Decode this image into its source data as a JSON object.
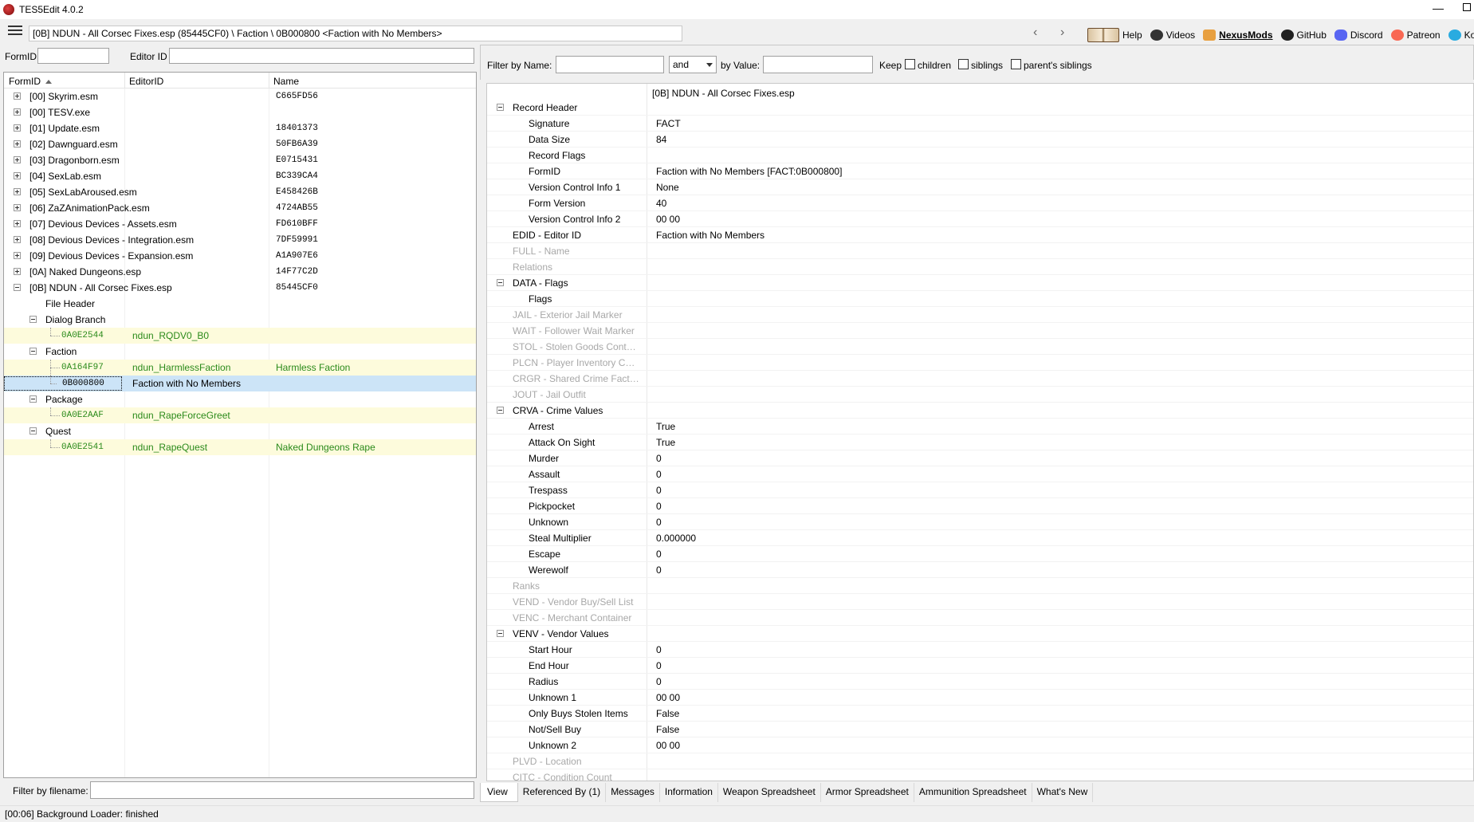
{
  "window": {
    "title": "TES5Edit 4.0.2"
  },
  "toolbar": {
    "path": "[0B] NDUN - All Corsec Fixes.esp (85445CF0) \\ Faction \\ 0B000800 <Faction with No Members>",
    "links": [
      {
        "label": "Help",
        "icon": "book-icon"
      },
      {
        "label": "Videos",
        "icon": "videos-icon"
      },
      {
        "label": "NexusMods",
        "icon": "nexusmods-icon"
      },
      {
        "label": "GitHub",
        "icon": "github-icon"
      },
      {
        "label": "Discord",
        "icon": "discord-icon"
      },
      {
        "label": "Patreon",
        "icon": "patreon-icon"
      },
      {
        "label": "Ko-Fi",
        "icon": "kofi-icon"
      }
    ]
  },
  "left": {
    "formid_label": "FormID",
    "editorid_label": "Editor ID",
    "formid_value": "",
    "editorid_value": "",
    "columns": [
      "FormID",
      "EditorID",
      "Name"
    ],
    "rows": [
      {
        "c1": "[00] Skyrim.esm",
        "c2": "",
        "c3": "C665FD56"
      },
      {
        "c1": "[00] TESV.exe",
        "c2": "",
        "c3": ""
      },
      {
        "c1": "[01] Update.esm",
        "c2": "",
        "c3": "18401373"
      },
      {
        "c1": "[02] Dawnguard.esm",
        "c2": "",
        "c3": "50FB6A39"
      },
      {
        "c1": "[03] Dragonborn.esm",
        "c2": "",
        "c3": "E0715431"
      },
      {
        "c1": "[04] SexLab.esm",
        "c2": "",
        "c3": "BC339CA4"
      },
      {
        "c1": "[05] SexLabAroused.esm",
        "c2": "",
        "c3": "E458426B"
      },
      {
        "c1": "[06] ZaZAnimationPack.esm",
        "c2": "",
        "c3": "4724AB55"
      },
      {
        "c1": "[07] Devious Devices - Assets.esm",
        "c2": "",
        "c3": "FD610BFF"
      },
      {
        "c1": "[08] Devious Devices - Integration.esm",
        "c2": "",
        "c3": "7DF59991"
      },
      {
        "c1": "[09] Devious Devices - Expansion.esm",
        "c2": "",
        "c3": "A1A907E6"
      },
      {
        "c1": "[0A] Naked Dungeons.esp",
        "c2": "",
        "c3": "14F77C2D"
      },
      {
        "c1": "[0B] NDUN - All Corsec Fixes.esp",
        "c2": "",
        "c3": "85445CF0"
      },
      {
        "c1": "File Header",
        "c2": "",
        "c3": ""
      },
      {
        "c1": "Dialog Branch",
        "c2": "",
        "c3": ""
      },
      {
        "c1": "0A0E2544",
        "c2": "ndun_RQDV0_B0",
        "c3": ""
      },
      {
        "c1": "Faction",
        "c2": "",
        "c3": ""
      },
      {
        "c1": "0A164F97",
        "c2": "ndun_HarmlessFaction",
        "c3": "Harmless Faction"
      },
      {
        "c1": "0B000800",
        "c2": "Faction with No Members",
        "c3": ""
      },
      {
        "c1": "Package",
        "c2": "",
        "c3": ""
      },
      {
        "c1": "0A0E2AAF",
        "c2": "ndun_RapeForceGreet",
        "c3": ""
      },
      {
        "c1": "Quest",
        "c2": "",
        "c3": ""
      },
      {
        "c1": "0A0E2541",
        "c2": "ndun_RapeQuest",
        "c3": "Naked Dungeons Rape"
      }
    ],
    "filter_label": "Filter by filename:",
    "filter_value": ""
  },
  "right": {
    "filter_name_label": "Filter by Name:",
    "filter_name_value": "",
    "operator": "and",
    "filter_value_label": "by Value:",
    "filter_value_value": "",
    "keep_label": "Keep",
    "checkboxes": [
      "children",
      "siblings",
      "parent's siblings"
    ],
    "file_header": "[0B] NDUN - All Corsec Fixes.esp",
    "rows": [
      {
        "name": "Record Header",
        "value": ""
      },
      {
        "name": "Signature",
        "value": "FACT"
      },
      {
        "name": "Data Size",
        "value": "84"
      },
      {
        "name": "Record Flags",
        "value": ""
      },
      {
        "name": "FormID",
        "value": "Faction with No Members [FACT:0B000800]"
      },
      {
        "name": "Version Control Info 1",
        "value": "None"
      },
      {
        "name": "Form Version",
        "value": "40"
      },
      {
        "name": "Version Control Info 2",
        "value": "00 00"
      },
      {
        "name": "EDID - Editor ID",
        "value": "Faction with No Members"
      },
      {
        "name": "FULL - Name",
        "value": ""
      },
      {
        "name": "Relations",
        "value": ""
      },
      {
        "name": "DATA - Flags",
        "value": ""
      },
      {
        "name": "Flags",
        "value": ""
      },
      {
        "name": "JAIL - Exterior Jail Marker",
        "value": ""
      },
      {
        "name": "WAIT - Follower Wait Marker",
        "value": ""
      },
      {
        "name": "STOL - Stolen Goods Contain...",
        "value": ""
      },
      {
        "name": "PLCN - Player Inventory Con...",
        "value": ""
      },
      {
        "name": "CRGR - Shared Crime Factio...",
        "value": ""
      },
      {
        "name": "JOUT - Jail Outfit",
        "value": ""
      },
      {
        "name": "CRVA - Crime Values",
        "value": ""
      },
      {
        "name": "Arrest",
        "value": "True"
      },
      {
        "name": "Attack On Sight",
        "value": "True"
      },
      {
        "name": "Murder",
        "value": "0"
      },
      {
        "name": "Assault",
        "value": "0"
      },
      {
        "name": "Trespass",
        "value": "0"
      },
      {
        "name": "Pickpocket",
        "value": "0"
      },
      {
        "name": "Unknown",
        "value": "0"
      },
      {
        "name": "Steal Multiplier",
        "value": "0.000000"
      },
      {
        "name": "Escape",
        "value": "0"
      },
      {
        "name": "Werewolf",
        "value": "0"
      },
      {
        "name": "Ranks",
        "value": ""
      },
      {
        "name": "VEND - Vendor Buy/Sell List",
        "value": ""
      },
      {
        "name": "VENC - Merchant Container",
        "value": ""
      },
      {
        "name": "VENV - Vendor Values",
        "value": ""
      },
      {
        "name": "Start Hour",
        "value": "0"
      },
      {
        "name": "End Hour",
        "value": "0"
      },
      {
        "name": "Radius",
        "value": "0"
      },
      {
        "name": "Unknown 1",
        "value": "00 00"
      },
      {
        "name": "Only Buys Stolen Items",
        "value": "False"
      },
      {
        "name": "Not/Sell Buy",
        "value": "False"
      },
      {
        "name": "Unknown 2",
        "value": "00 00"
      },
      {
        "name": "PLVD - Location",
        "value": ""
      },
      {
        "name": "CITC - Condition Count",
        "value": ""
      }
    ],
    "tabs": [
      "View",
      "Referenced By (1)",
      "Messages",
      "Information",
      "Weapon Spreadsheet",
      "Armor Spreadsheet",
      "Ammunition Spreadsheet",
      "What's New"
    ]
  },
  "status": {
    "text": "[00:06] Background Loader: finished"
  }
}
